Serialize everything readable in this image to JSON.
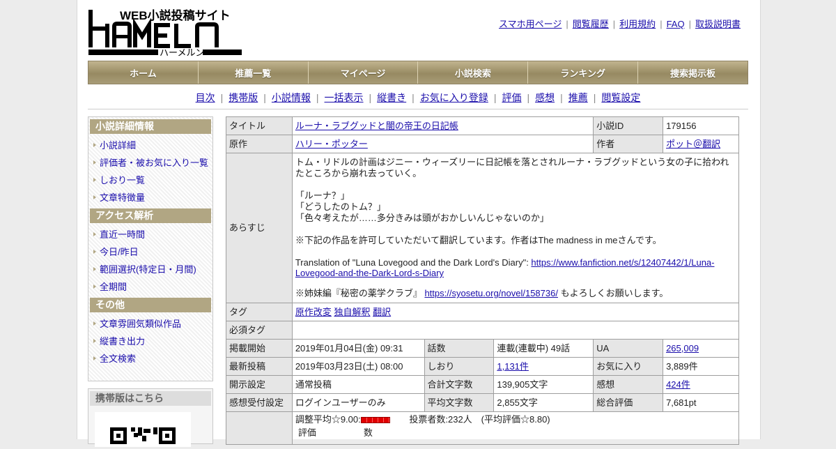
{
  "site": {
    "logo_web_text": "WEB小説投稿サイト",
    "logo_name": "HAMELN",
    "logo_kana": "ハーメルン"
  },
  "header_links": [
    "スマホ用ページ",
    "閲覧履歴",
    "利用規約",
    "FAQ",
    "取扱説明書"
  ],
  "nav": [
    "ホーム",
    "推薦一覧",
    "マイページ",
    "小説検索",
    "ランキング",
    "捜索掲示板"
  ],
  "subnav": [
    "目次",
    "携帯版",
    "小説情報",
    "一括表示",
    "縦書き",
    "お気に入り登録",
    "評価",
    "感想",
    "推薦",
    "閲覧設定"
  ],
  "sidebar": {
    "sections": [
      {
        "title": "小説詳細情報",
        "items": [
          "小説詳細",
          "評価者・被お気に入り一覧",
          "しおり一覧",
          "文章特徴量"
        ]
      },
      {
        "title": "アクセス解析",
        "items": [
          "直近一時間",
          "今日/昨日",
          "範囲選択(特定日・月間)",
          "全期間"
        ]
      },
      {
        "title": "その他",
        "items": [
          "文章雰囲気類似作品",
          "縦書き出力",
          "全文検索"
        ]
      }
    ],
    "mobile_title": "携帯版はこちら"
  },
  "info": {
    "title_label": "タイトル",
    "title": "ルーナ・ラブグッドと闇の帝王の日記帳",
    "novel_id_label": "小説ID",
    "novel_id": "179156",
    "original_label": "原作",
    "original": "ハリー・ポッター",
    "author_label": "作者",
    "author": "ポット＠翻訳",
    "synopsis_label": "あらすじ",
    "synopsis": {
      "p1": "トム・リドルの計画はジニー・ウィーズリーに日記帳を落とされルーナ・ラブグッドという女の子に拾われたところから崩れ去っていく。",
      "d1": "「ルーナ？」",
      "d2": "「どうしたのトム？」",
      "d3": "「色々考えたが……多分きみは頭がおかしいんじゃないのか」",
      "p2": "※下記の作品を許可していただいて翻訳しています。作者はThe madness in meさんです。",
      "p3_prefix": "Translation of \"Luna Lovegood and the Dark Lord's Diary\": ",
      "p3_link": "https://www.fanfiction.net/s/12407442/1/Luna-Lovegood-and-the-Dark-Lord-s-Diary",
      "p4_prefix": "※姉妹編『秘密の薬学クラブ』 ",
      "p4_link": "https://syosetu.org/novel/158736/",
      "p4_suffix": " もよろしくお願いします。"
    },
    "tags_label": "タグ",
    "tags": [
      "原作改変",
      "独自解釈",
      "翻訳"
    ],
    "required_tags_label": "必須タグ",
    "start_label": "掲載開始",
    "start": "2019年01月04日(金) 09:31",
    "chapters_label": "話数",
    "chapters": "連載(連載中) 49話",
    "ua_label": "UA",
    "ua": "265,009",
    "latest_label": "最新投稿",
    "latest": "2019年03月23日(土) 08:00",
    "bookmarks_label": "しおり",
    "bookmarks": "1,131件",
    "favorites_label": "お気に入り",
    "favorites": "3,889件",
    "disclosure_label": "開示設定",
    "disclosure": "通常投稿",
    "total_chars_label": "合計文字数",
    "total_chars": "139,905文字",
    "reviews_label": "感想",
    "reviews": "424件",
    "review_accept_label": "感想受付設定",
    "review_accept": "ログインユーザーのみ",
    "avg_chars_label": "平均文字数",
    "avg_chars": "2,855文字",
    "overall_label": "総合評価",
    "overall": "7,681pt",
    "rating_avg": "調整平均☆9.00:",
    "voters": "投票者数:232人　(平均評価☆8.80)",
    "rating_col": "評価",
    "count_col": "数"
  },
  "colors": {
    "nav_gold": "#a89c77",
    "side_head": "#b1a683",
    "rating_bar": "#e00000"
  }
}
